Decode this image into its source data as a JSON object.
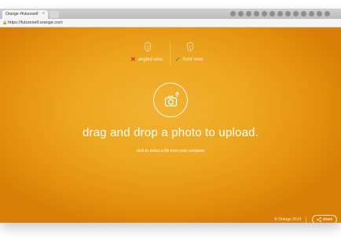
{
  "browser": {
    "tab_title": "Orange #futureself",
    "tab_close": "×",
    "url": "https://futureself.orange.com",
    "lock_glyph": "🔒"
  },
  "views": {
    "angled": {
      "mark": "✕",
      "label": "angled view",
      "status": "rejected"
    },
    "front": {
      "mark": "✓",
      "label": "front view",
      "status": "accepted"
    }
  },
  "upload": {
    "headline": "drag and drop a photo to upload.",
    "subline": "click to select a file from your computer"
  },
  "footer": {
    "copyright": "© Orange 2014",
    "share_label": "share"
  },
  "colors": {
    "background_center": "#f3b233",
    "background_edge": "#d97f07",
    "reject": "#d0291a",
    "accept": "#4ba23f"
  },
  "icons": {
    "camera": "camera-icon",
    "share": "share-icon",
    "face": "face-outline-icon"
  }
}
